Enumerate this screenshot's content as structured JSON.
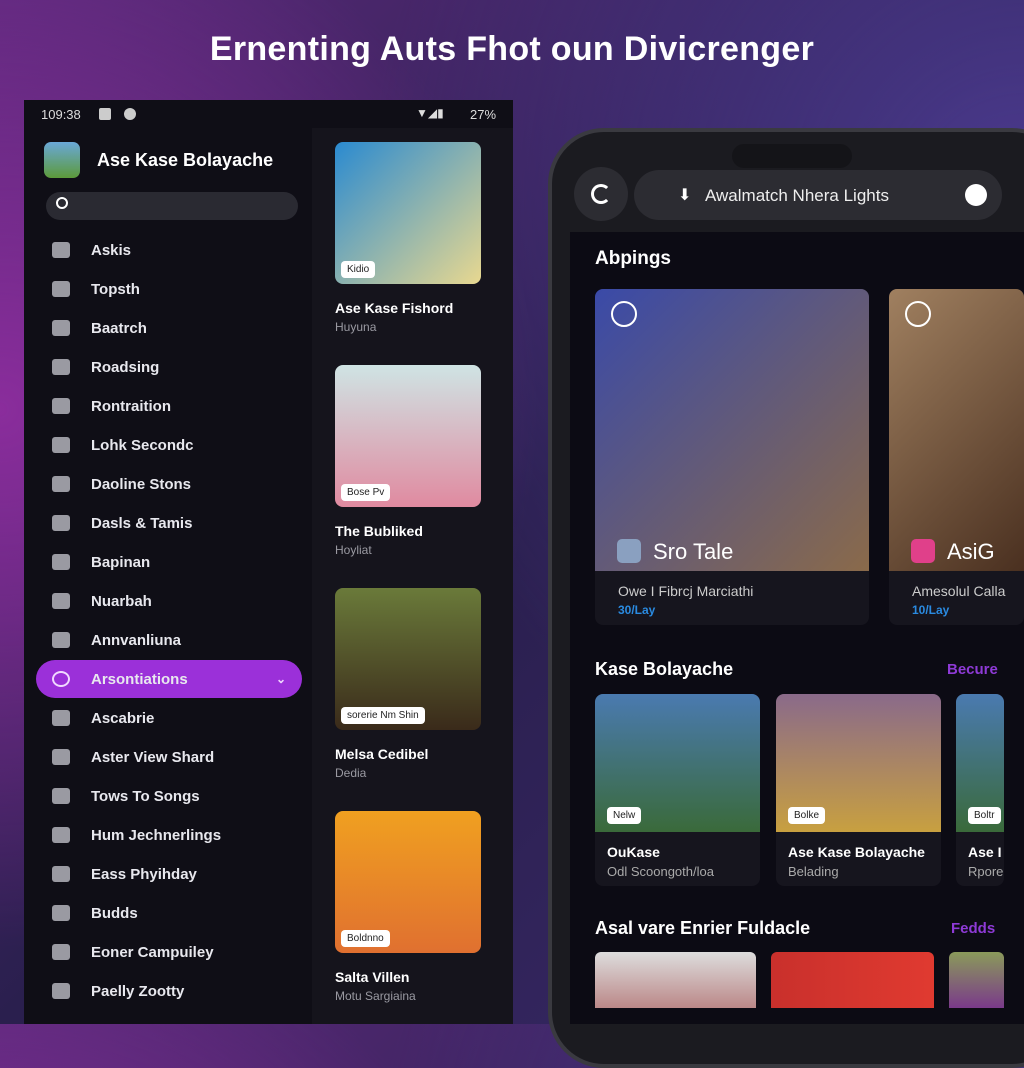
{
  "headline": "Ernenting Auts Fhot oun Divicrenger",
  "status": {
    "time": "109:38",
    "battery": "27%"
  },
  "sidebar": {
    "app_name": "Ase Kase Bolayache",
    "search_placeholder": "",
    "items": [
      {
        "label": "Askis"
      },
      {
        "label": "Topsth"
      },
      {
        "label": "Baatrch"
      },
      {
        "label": "Roadsing"
      },
      {
        "label": "Rontraition"
      },
      {
        "label": "Lohk Secondc"
      },
      {
        "label": "Daoline Stons"
      },
      {
        "label": "Dasls & Tamis"
      },
      {
        "label": "Bapinan"
      },
      {
        "label": "Nuarbah"
      },
      {
        "label": "Annvanliuna"
      },
      {
        "label": "Arsontiations",
        "active": true
      },
      {
        "label": "Ascabrie"
      },
      {
        "label": "Aster View Shard"
      },
      {
        "label": "Tows To Songs"
      },
      {
        "label": "Hum Jechnerlings"
      },
      {
        "label": "Eass Phyihday"
      },
      {
        "label": "Budds"
      },
      {
        "label": "Eoner Campuiley"
      },
      {
        "label": "Paelly Zootty"
      }
    ],
    "accent": "#9b30d9"
  },
  "grid": [
    {
      "title": "Ase Kase Fishord",
      "subtitle": "Huyuna",
      "tag": "Kidio"
    },
    {
      "title": "The Bubliked",
      "subtitle": "Hoyliat",
      "tag": "Bose Pv"
    },
    {
      "title": "Melsa Cedibel",
      "subtitle": "Dedia",
      "tag": "sorerie Nm Shin"
    },
    {
      "title": "Salta Villen",
      "subtitle": "Motu Sargiaina",
      "tag": "Boldnno"
    }
  ],
  "phone": {
    "search_text": "Awalmatch Nhera Lights",
    "featured_heading": "Abpings",
    "featured": [
      {
        "title": "Sro Tale",
        "subtitle": "Owe I Fibrcj Marciathi",
        "meta": "30/Lay"
      },
      {
        "title": "AsiG",
        "subtitle": "Amesolul Calla",
        "meta": "10/Lay"
      }
    ],
    "section1": {
      "heading": "Kase Bolayache",
      "more": "Becure",
      "cards": [
        {
          "title": "OuKase",
          "subtitle": "Odl Scoongoth/loa",
          "tag": "Nelw"
        },
        {
          "title": "Ase Kase Bolayache",
          "subtitle": "Belading",
          "tag": "Bolke"
        },
        {
          "title": "Ase I",
          "subtitle": "Rpore",
          "tag": "Boltr"
        }
      ]
    },
    "section2": {
      "heading": "Asal vare Enrier Fuldacle",
      "more": "Fedds"
    }
  }
}
